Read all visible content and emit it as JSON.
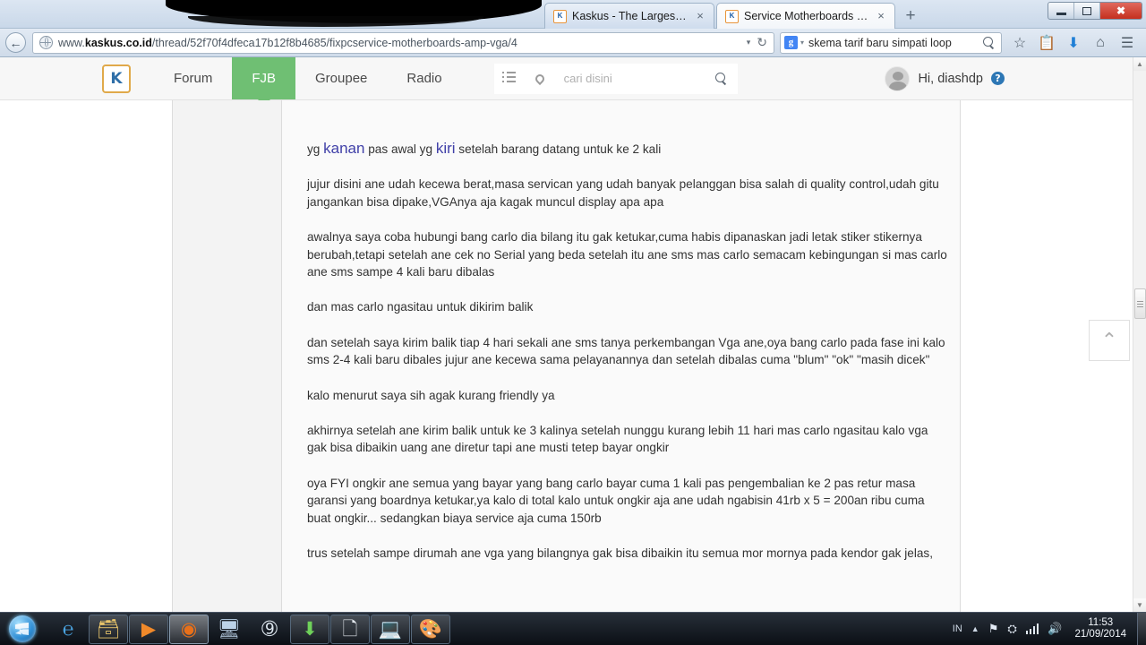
{
  "browser": {
    "tabs": [
      {
        "title": "Kaskus - The Largest Indon...",
        "favicon": "kaskus-favicon",
        "active": false,
        "close": "×"
      },
      {
        "title": "Service Motherboards & V...",
        "favicon": "kaskus-favicon",
        "active": true,
        "close": "×"
      }
    ],
    "new_tab_label": "+",
    "window_controls": {
      "minimize": "–",
      "maximize": "❐",
      "close": "✖"
    },
    "back_label": "←",
    "url": {
      "prefix": "www.",
      "domain": "kaskus.co.id",
      "path": "/thread/52f70f4dfeca17b12f8b4685/fixpcservice-motherboards-amp-vga/4",
      "full": "www.kaskus.co.id/thread/52f70f4dfeca17b12f8b4685/fixpcservice-motherboards-amp-vga/4",
      "dropdown_caret": "▾",
      "reload_label": "↻"
    },
    "search": {
      "engine_letter": "g",
      "engine_caret": "▾",
      "value": "skema tarif baru simpati loop"
    },
    "toolbar_icons": [
      {
        "name": "bookmark-star-icon",
        "glyph": "☆"
      },
      {
        "name": "reading-list-icon",
        "glyph": "Ὄb"
      },
      {
        "name": "downloads-icon",
        "glyph": "↓"
      },
      {
        "name": "home-icon",
        "glyph": "⌂"
      },
      {
        "name": "menu-hamburger-icon",
        "glyph": "☰"
      }
    ]
  },
  "site": {
    "logo_text": "K",
    "nav": [
      {
        "label": "Forum",
        "active": false
      },
      {
        "label": "FJB",
        "active": true
      },
      {
        "label": "Groupee",
        "active": false
      },
      {
        "label": "Radio",
        "active": false
      }
    ],
    "search_placeholder": "cari disini",
    "user_greeting": "Hi, diashdp",
    "help_badge": "?",
    "accent_green": "#6fbf73",
    "logo_border": "#e0a94a"
  },
  "post": {
    "highlight_color": "#4040a8",
    "paragraphs": [
      {
        "type": "mixed",
        "parts": [
          {
            "text": "yg ",
            "hl": false
          },
          {
            "text": "kanan",
            "hl": true
          },
          {
            "text": " pas awal yg ",
            "hl": false
          },
          {
            "text": "kiri",
            "hl": true
          },
          {
            "text": " setelah barang datang untuk ke 2 kali",
            "hl": false
          }
        ]
      },
      {
        "type": "text",
        "text": "jujur disini ane udah kecewa berat,masa servican yang udah banyak pelanggan bisa salah di quality control,udah gitu jangankan bisa dipake,VGAnya aja kagak muncul display apa apa"
      },
      {
        "type": "text",
        "text": "awalnya saya coba hubungi bang carlo dia bilang itu gak ketukar,cuma habis dipanaskan jadi letak stiker stikernya berubah,tetapi setelah ane cek no Serial yang beda setelah itu ane sms mas carlo semacam kebingungan si mas carlo ane sms sampe 4 kali baru dibalas"
      },
      {
        "type": "text",
        "text": "dan mas carlo ngasitau untuk dikirim balik"
      },
      {
        "type": "text",
        "text": "dan setelah saya kirim balik tiap 4 hari sekali ane sms tanya perkembangan Vga ane,oya bang carlo pada fase ini kalo sms 2-4 kali baru dibales jujur ane kecewa sama pelayanannya dan setelah dibalas cuma \"blum\" \"ok\" \"masih dicek\""
      },
      {
        "type": "text",
        "text": "kalo menurut saya sih agak kurang friendly ya"
      },
      {
        "type": "text",
        "text": "akhirnya setelah ane kirim balik untuk ke 3 kalinya setelah nunggu kurang lebih 11 hari mas carlo ngasitau kalo vga gak bisa dibaikin uang ane diretur tapi ane musti tetep bayar ongkir"
      },
      {
        "type": "text",
        "text": "oya FYI ongkir ane semua yang bayar yang bang carlo bayar cuma 1 kali pas pengembalian ke 2 pas retur masa garansi yang boardnya ketukar,ya kalo di total kalo untuk ongkir aja ane udah ngabisin 41rb x 5 = 200an ribu cuma buat ongkir... sedangkan biaya service aja cuma 150rb"
      },
      {
        "type": "text",
        "text": "trus setelah sampe dirumah ane vga yang bilangnya gak bisa dibaikin itu semua mor mornya pada kendor gak jelas,"
      }
    ]
  },
  "scroll_top_button": {
    "glyph": "⌃"
  },
  "page_scrollbar": {
    "up": "▲",
    "down": "▼"
  },
  "taskbar": {
    "start_label": "Start",
    "items": [
      {
        "name": "taskbar-internet-explorer",
        "glyph": "℮",
        "state": "none"
      },
      {
        "name": "taskbar-windows-explorer",
        "glyph": "🗀",
        "state": "open"
      },
      {
        "name": "taskbar-media-player",
        "glyph": "▶",
        "state": "open"
      },
      {
        "name": "taskbar-firefox",
        "glyph": "🦊",
        "state": "pressed"
      },
      {
        "name": "taskbar-remote-desktop",
        "glyph": "🖥",
        "state": "none"
      },
      {
        "name": "taskbar-steam",
        "glyph": "⚈",
        "state": "none"
      },
      {
        "name": "taskbar-installer",
        "glyph": "⬇",
        "state": "open"
      },
      {
        "name": "taskbar-notepad",
        "glyph": "🗋",
        "state": "open"
      },
      {
        "name": "taskbar-system-monitor",
        "glyph": "💻",
        "state": "open"
      },
      {
        "name": "taskbar-paint",
        "glyph": "🎨",
        "state": "open"
      }
    ],
    "tray": {
      "language": "IN",
      "show_hidden": "▲",
      "flag_icon": "⚑",
      "action_center_icon": "⛭",
      "network_icon": "signal-bars",
      "volume_icon": "🔊",
      "time": "11:53",
      "date": "21/09/2014"
    }
  }
}
